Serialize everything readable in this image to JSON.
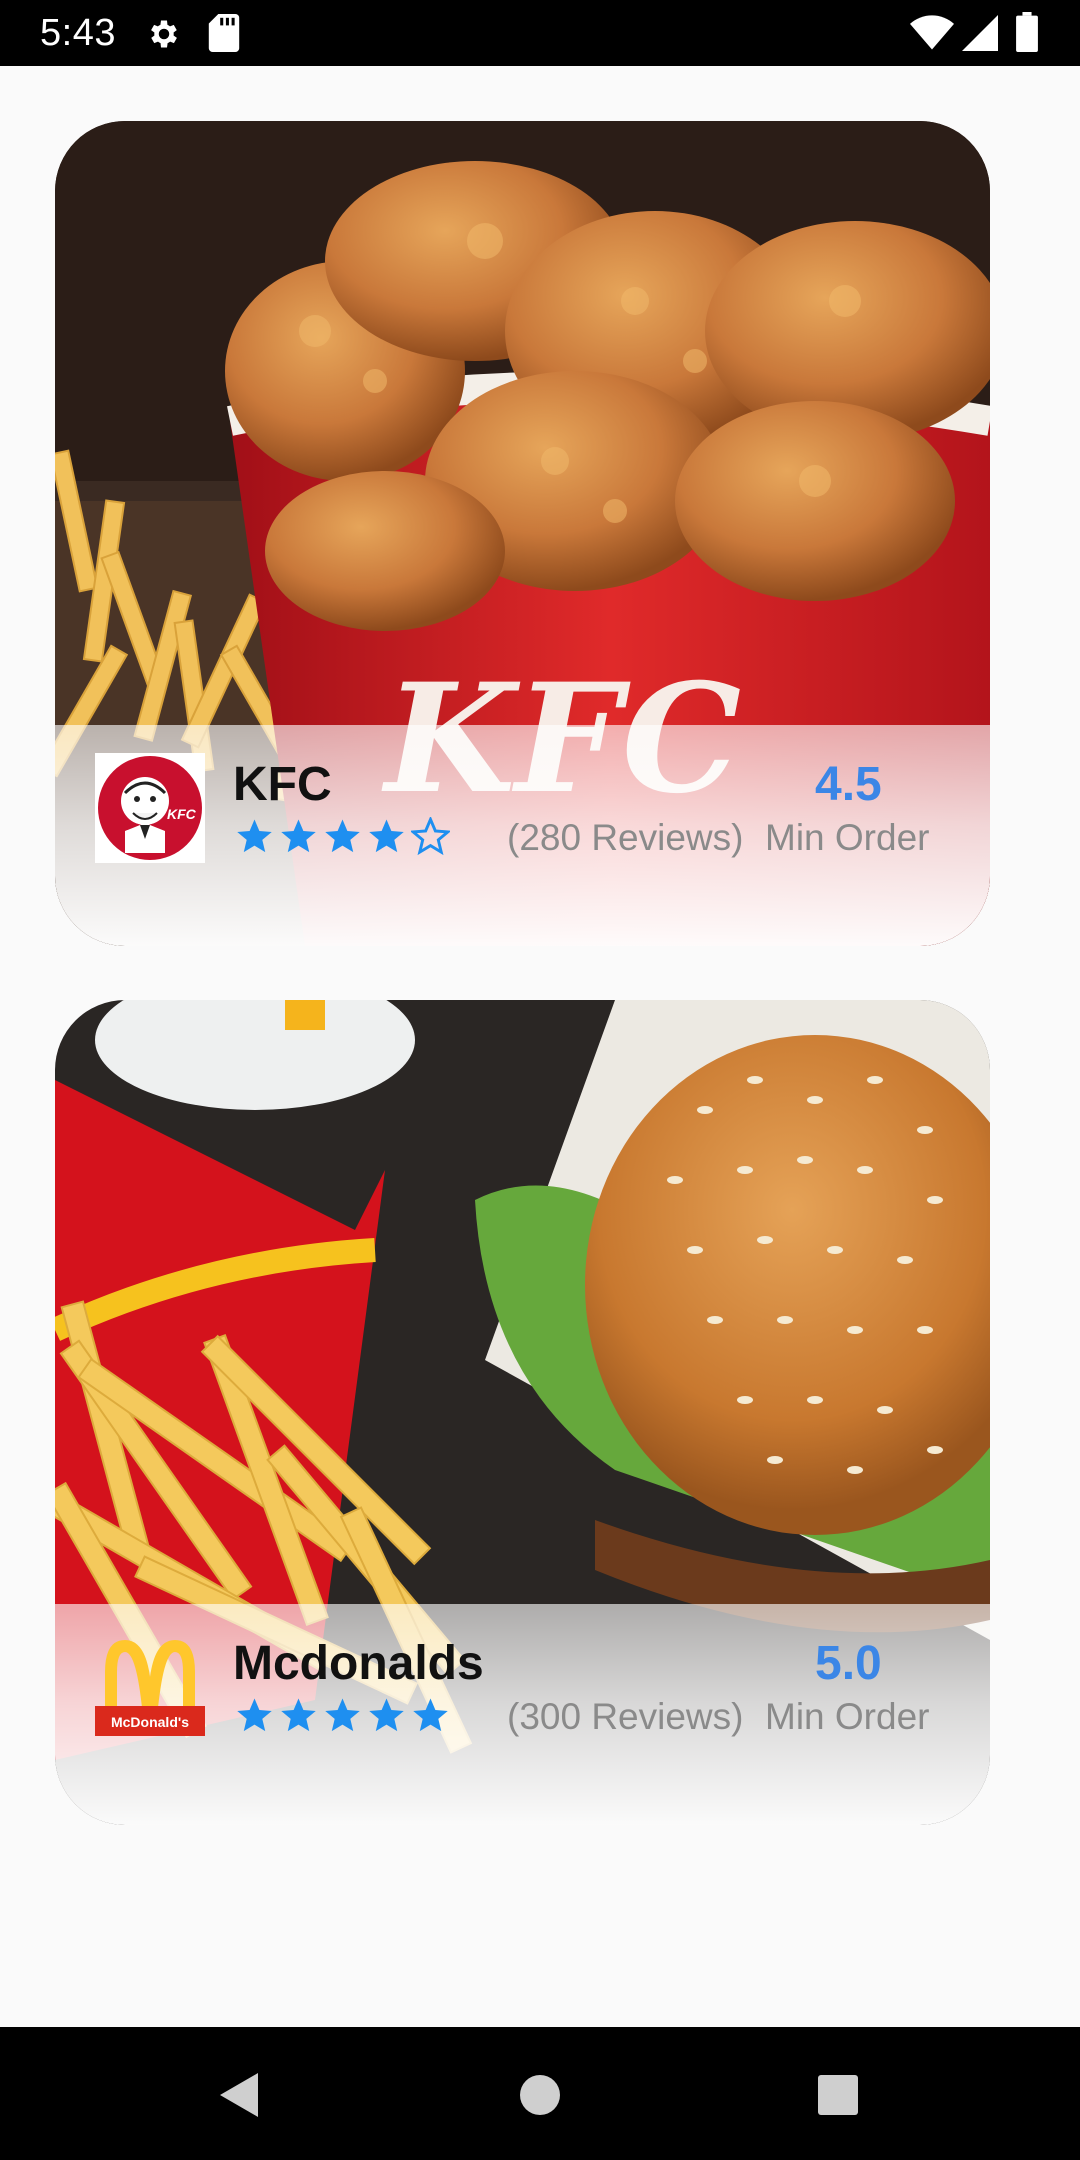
{
  "status_bar": {
    "time": "5:43",
    "icons": [
      "settings-gear-icon",
      "sd-card-icon",
      "wifi-icon",
      "cell-signal-icon",
      "battery-icon"
    ]
  },
  "restaurants": [
    {
      "name": "KFC",
      "logo": "kfc-colonel-logo",
      "photo": "fried-chicken-bucket-photo",
      "rating_stars": 4,
      "reviews": "(280 Reviews)",
      "rating_value": "4.5",
      "min_order_label": "Min Order",
      "logo_text": "KFC"
    },
    {
      "name": "Mcdonalds",
      "logo": "mcdonalds-golden-arches-logo",
      "photo": "burger-and-fries-photo",
      "rating_stars": 5,
      "reviews": "(300 Reviews)",
      "rating_value": "5.0",
      "min_order_label": "Min Order",
      "logo_text": "McDonald's"
    }
  ],
  "colors": {
    "star_blue": "#1e8ff0",
    "rating_blue": "#3b86e6",
    "muted_text": "#8a8a8a",
    "kfc_red": "#c8102e",
    "mcd_yellow": "#ffc72c"
  },
  "nav_bar": {
    "buttons": [
      "back-triangle-icon",
      "home-circle-icon",
      "recents-square-icon"
    ]
  }
}
